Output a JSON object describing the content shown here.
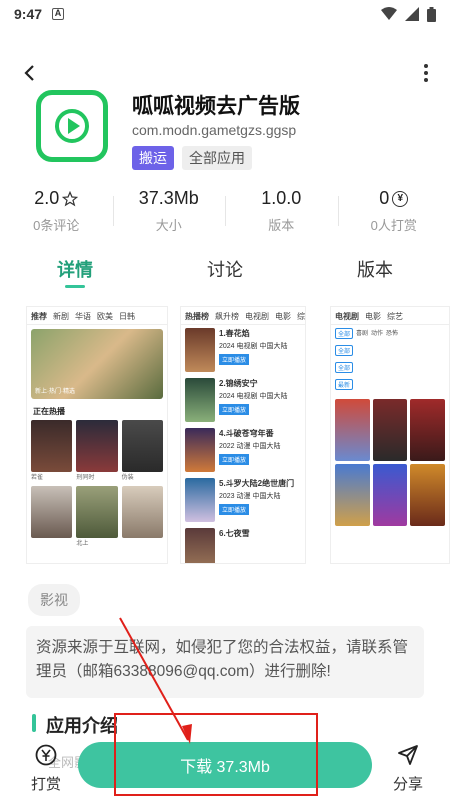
{
  "status_bar": {
    "time": "9:47",
    "sim_label": "A"
  },
  "app": {
    "name": "呱呱视频去广告版",
    "package": "com.modn.gametgzs.ggsp",
    "tags": [
      "搬运",
      "全部应用"
    ]
  },
  "stats": [
    {
      "value": "2.0",
      "label": "0条评论",
      "icon": "star-icon"
    },
    {
      "value": "37.3Mb",
      "label": "大小"
    },
    {
      "value": "1.0.0",
      "label": "版本"
    },
    {
      "value": "0",
      "label": "0人打赏",
      "icon": "yen-icon"
    }
  ],
  "tabs": [
    {
      "label": "详情",
      "active": true
    },
    {
      "label": "讨论",
      "active": false
    },
    {
      "label": "版本",
      "active": false
    }
  ],
  "screenshots": {
    "s1_tabs": [
      "推荐",
      "新剧",
      "华语",
      "欧美",
      "日韩"
    ],
    "s1_banner_title": "新上·热门·精选",
    "s1_hot": "正在热播",
    "s1_caps": [
      "若雀",
      "刑同时",
      "伪装",
      "",
      "北上",
      ""
    ],
    "s2_tabs": [
      "热播榜",
      "飙升榜",
      "电视剧",
      "电影",
      "综艺"
    ],
    "s2_items": [
      {
        "title": "1.春花焰",
        "meta": "2024 电视剧 中国大陆",
        "btn": "立即播放"
      },
      {
        "title": "2.锦绣安宁",
        "meta": "2024 电视剧 中国大陆",
        "btn": "立即播放"
      },
      {
        "title": "4.斗破苍穹年番",
        "meta": "2022 动漫 中国大陆",
        "btn": "立即播放"
      },
      {
        "title": "5.斗罗大陆2绝世唐门",
        "meta": "2023 动漫 中国大陆",
        "btn": "立即播放"
      },
      {
        "title": "6.七夜雪",
        "meta": "",
        "btn": ""
      }
    ],
    "s3_tabs": [
      "电视剧",
      "电影",
      "综艺"
    ],
    "s3_chips": [
      "全部",
      "全部",
      "全部",
      "最新"
    ],
    "s3_caps": [
      "喜剧",
      "动作",
      "恐怖"
    ]
  },
  "category_tag": "影视",
  "disclaimer": "资源来源于互联网，如侵犯了您的合法权益，请联系管理员（邮箱63388096@qq.com）进行删除!",
  "section_title": "应用介绍",
  "faded_text": "全网影视",
  "bottom": {
    "tip_label": "打赏",
    "download_label": "下载 37.3Mb",
    "share_label": "分享"
  },
  "colors": {
    "accent": "#3ec4a0",
    "tab_active": "#22a07a",
    "tag_purple": "#6d62e8",
    "app_icon_green": "#22c55e",
    "annotation_red": "#e0201a"
  }
}
